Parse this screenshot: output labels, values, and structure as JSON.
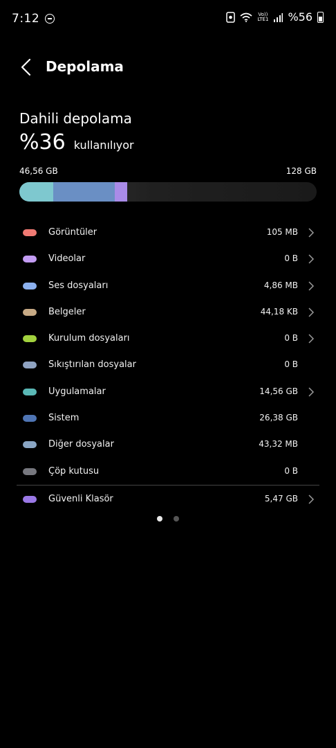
{
  "status_bar": {
    "time": "7:12",
    "network_label_top": "Vo))",
    "network_label_bottom": "LTE1",
    "battery_text": "%56"
  },
  "header": {
    "title": "Depolama"
  },
  "storage": {
    "section_title": "Dahili depolama",
    "used_percent": "%36",
    "used_label": "kullanılıyor",
    "used_amount": "46,56 GB",
    "total": "128 GB",
    "bar_fractions": {
      "apps": 0.114,
      "system": 0.206,
      "secure_folder": 0.043
    },
    "bar_colors": {
      "apps": "#7ec8cf",
      "system": "#6a8fc4",
      "secure_folder": "#a98be8"
    }
  },
  "categories": [
    {
      "label": "Görüntüler",
      "size": "105 MB",
      "color": "#f07a73",
      "chevron": true
    },
    {
      "label": "Videolar",
      "size": "0 B",
      "color": "#c39cf3",
      "chevron": true
    },
    {
      "label": "Ses dosyaları",
      "size": "4,86 MB",
      "color": "#8cb1ef",
      "chevron": true
    },
    {
      "label": "Belgeler",
      "size": "44,18 KB",
      "color": "#c7aa85",
      "chevron": true
    },
    {
      "label": "Kurulum dosyaları",
      "size": "0 B",
      "color": "#a2d13e",
      "chevron": true
    },
    {
      "label": "Sıkıştırılan dosyalar",
      "size": "0 B",
      "color": "#8fa3c2",
      "chevron": false
    },
    {
      "label": "Uygulamalar",
      "size": "14,56 GB",
      "color": "#5ab8b6",
      "chevron": true
    },
    {
      "label": "Sistem",
      "size": "26,38 GB",
      "color": "#4f75b4",
      "chevron": false
    },
    {
      "label": "Diğer dosyalar",
      "size": "43,32 MB",
      "color": "#8aa6c4",
      "chevron": false
    },
    {
      "label": "Çöp kutusu",
      "size": "0 B",
      "color": "#77787f",
      "chevron": false
    }
  ],
  "secure_folder": {
    "label": "Güvenli Klasör",
    "size": "5,47 GB",
    "color": "#9a78e6"
  },
  "pager": {
    "active_color": "#e8e8e8",
    "inactive_color": "#555555"
  }
}
